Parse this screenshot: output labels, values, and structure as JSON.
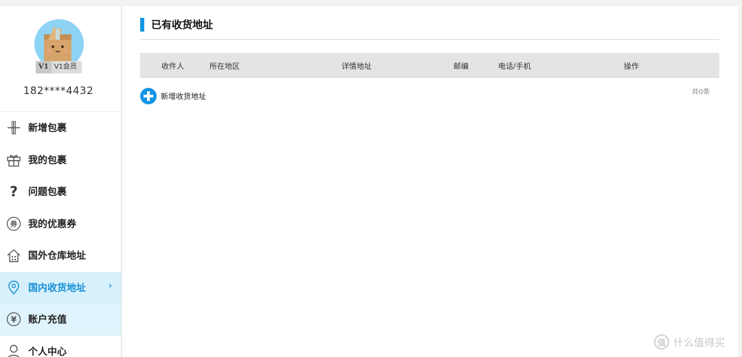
{
  "profile": {
    "level": "V1",
    "level_name": "V1会员",
    "phone": "182****4432"
  },
  "sidebar": {
    "items": [
      {
        "label": "新增包裹",
        "icon": "plus-icon"
      },
      {
        "label": "我的包裹",
        "icon": "gift-box-icon"
      },
      {
        "label": "问题包裹",
        "icon": "question-icon"
      },
      {
        "label": "我的优惠券",
        "icon": "coupon-icon"
      },
      {
        "label": "国外仓库地址",
        "icon": "house-icon"
      },
      {
        "label": "国内收货地址",
        "icon": "location-pin-icon",
        "chevron": "›"
      },
      {
        "label": "账户充值",
        "icon": "yuan-icon"
      },
      {
        "label": "个人中心",
        "icon": "person-icon"
      }
    ]
  },
  "main": {
    "title": "已有收货地址",
    "columns": [
      "收件人",
      "所在地区",
      "详情地址",
      "邮编",
      "电话/手机",
      "操作"
    ],
    "add_label": "新增收货地址",
    "total": "共0条"
  },
  "watermark": {
    "text": "什么值得买",
    "icon_char": "值"
  },
  "colors": {
    "accent": "#1596e3",
    "active_bg": "#d6f1fb"
  }
}
